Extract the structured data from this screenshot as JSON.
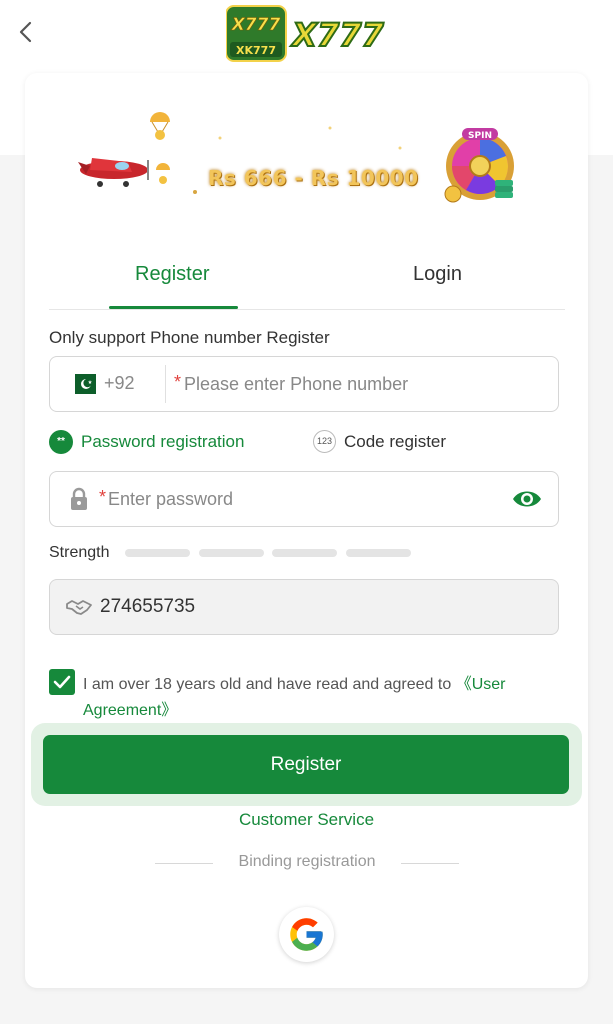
{
  "header": {
    "back_icon": "chevron-left-icon",
    "logo_small_text": "XK777",
    "logo_big_text": "X777"
  },
  "banner": {
    "promo_text": "Rs 666 - Rs 10000",
    "wheel_label": "SPIN"
  },
  "tabs": [
    {
      "label": "Register",
      "active": true
    },
    {
      "label": "Login",
      "active": false
    }
  ],
  "form": {
    "hint": "Only support Phone number Register",
    "phone": {
      "country_code": "+92",
      "required_mark": "*",
      "placeholder": "Please enter Phone number",
      "value": ""
    },
    "modes": [
      {
        "label": "Password registration",
        "icon_text": "**",
        "active": true
      },
      {
        "label": "Code register",
        "icon_text": "123",
        "active": false
      }
    ],
    "password": {
      "required_mark": "*",
      "placeholder": "Enter password",
      "value": ""
    },
    "strength": {
      "label": "Strength",
      "level": 0,
      "segments": 4
    },
    "invite_code": {
      "value": "274655735"
    },
    "agreement": {
      "checked": true,
      "text": "I am over 18 years old and have read and agreed to ",
      "link": "《User Agreement》"
    },
    "submit_label": "Register"
  },
  "customer_service": "Customer Service",
  "binding_label": "Binding registration",
  "social": [
    {
      "name": "google-icon"
    }
  ],
  "colors": {
    "accent": "#16893b",
    "required": "#e0413d",
    "background": "#f5f5f5",
    "glow": "#e2f1e4"
  }
}
